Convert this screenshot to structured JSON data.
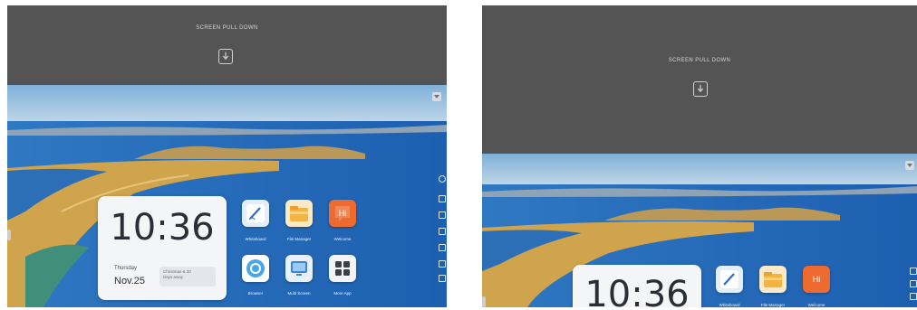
{
  "left_panel": {
    "pulldown": {
      "label": "SCREEN PULL DOWN",
      "icon": "pull-down-arrow-icon"
    },
    "clock": {
      "time": "10:36",
      "day": "Thursday",
      "date": "Nov.25",
      "note_line1": "Christmas & 30",
      "note_line2": "Days away"
    },
    "apps": [
      {
        "label": "Whiteboard",
        "icon": "whiteboard-pen-icon",
        "color": "#d8e6f5"
      },
      {
        "label": "File Manager",
        "icon": "folder-icon",
        "color": "#f2b84a"
      },
      {
        "label": "Welcome",
        "icon": "welcome-hi-icon",
        "color": "#ee6a2e"
      },
      {
        "label": "Browser",
        "icon": "browser-icon",
        "color": "#4aa6e8"
      },
      {
        "label": "Multi Screen",
        "icon": "multi-screen-icon",
        "color": "#3a86d8"
      },
      {
        "label": "More App",
        "icon": "app-grid-icon",
        "color": "#3c4046"
      }
    ]
  },
  "right_panel": {
    "pulldown": {
      "label": "SCREEN PULL DOWN",
      "icon": "pull-down-arrow-icon"
    },
    "clock": {
      "time": "10:36"
    },
    "apps": [
      {
        "label": "Whiteboard",
        "icon": "whiteboard-pen-icon"
      },
      {
        "label": "File Manager",
        "icon": "folder-icon"
      },
      {
        "label": "Welcome",
        "icon": "welcome-hi-icon"
      }
    ]
  },
  "welcome_glyph": "Hi"
}
